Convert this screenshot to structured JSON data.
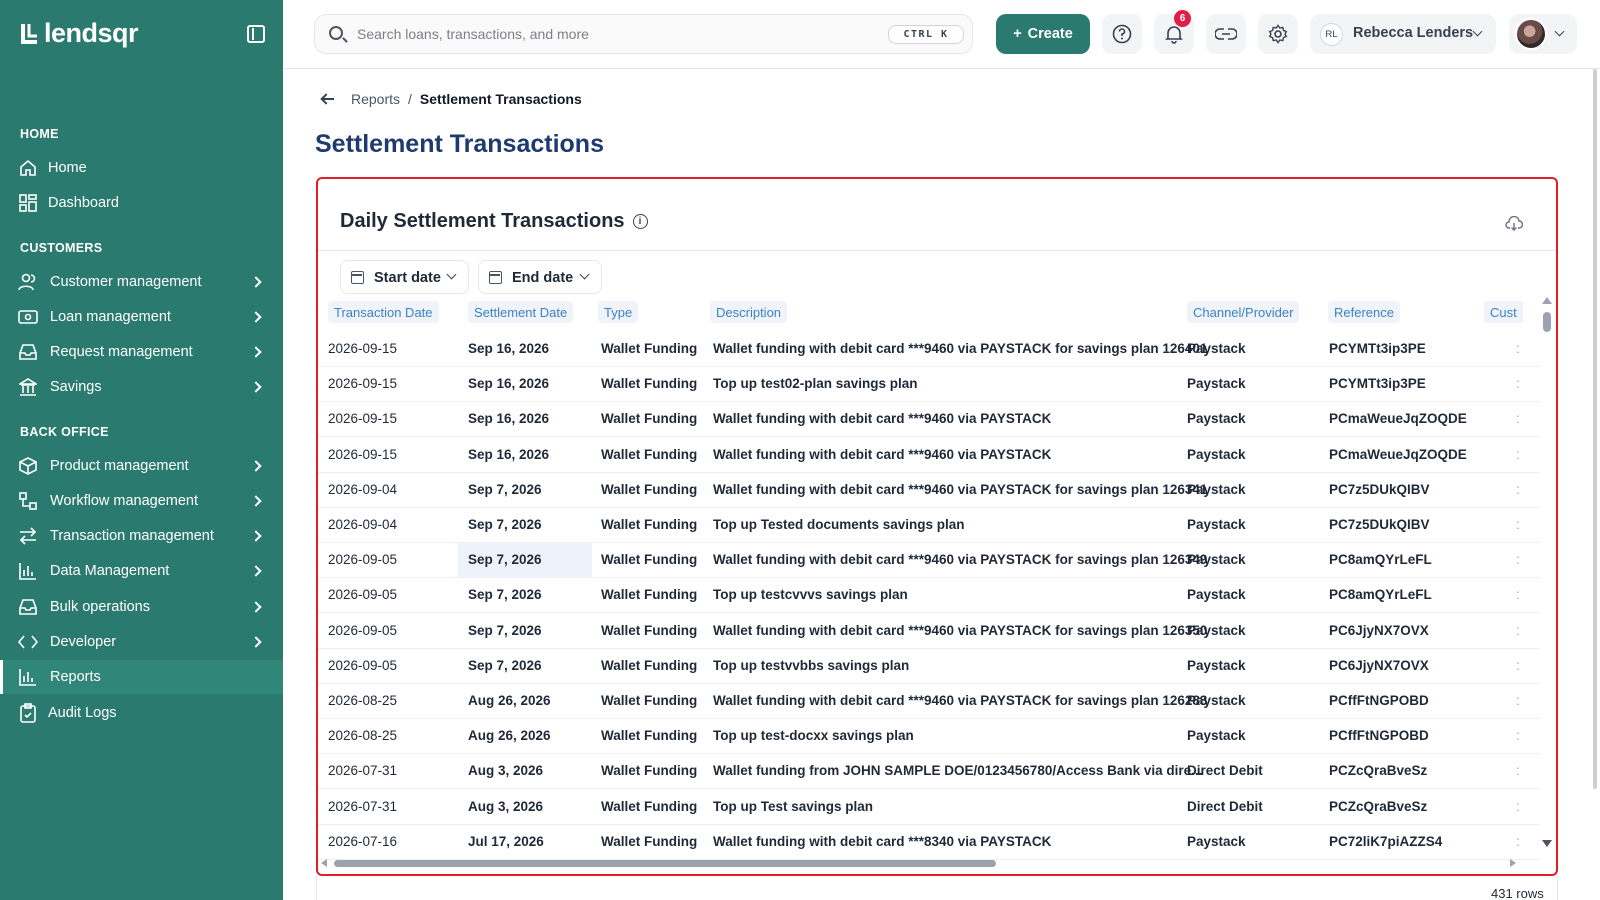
{
  "brand": {
    "name": "lendsqr"
  },
  "sidebar": {
    "sections": {
      "home": "HOME",
      "customers": "CUSTOMERS",
      "back_office": "BACK OFFICE"
    },
    "items": [
      {
        "label": "Home",
        "icon": "home-icon"
      },
      {
        "label": "Dashboard",
        "icon": "dashboard-icon"
      },
      {
        "label": "Customer management",
        "icon": "users-icon"
      },
      {
        "label": "Loan management",
        "icon": "loan-icon"
      },
      {
        "label": "Request management",
        "icon": "inbox-icon"
      },
      {
        "label": "Savings",
        "icon": "savings-icon"
      },
      {
        "label": "Product management",
        "icon": "box-icon"
      },
      {
        "label": "Workflow management",
        "icon": "workflow-icon"
      },
      {
        "label": "Transaction management",
        "icon": "transfer-icon"
      },
      {
        "label": "Data Management",
        "icon": "bar-chart-icon"
      },
      {
        "label": "Bulk operations",
        "icon": "inbox-icon"
      },
      {
        "label": "Developer",
        "icon": "code-icon"
      },
      {
        "label": "Reports",
        "icon": "bar-chart-icon"
      },
      {
        "label": "Audit Logs",
        "icon": "clipboard-icon"
      }
    ]
  },
  "topbar": {
    "search_placeholder": "Search loans, transactions, and more",
    "shortcut": "CTRL K",
    "create_label": "Create",
    "notifications_count": "6",
    "user_initials": "RL",
    "user_name": "Rebecca Lenders"
  },
  "breadcrumb": {
    "parent": "Reports",
    "separator": "/",
    "current": "Settlement Transactions"
  },
  "page_title": "Settlement Transactions",
  "report": {
    "title": "Daily Settlement Transactions",
    "start_date_label": "Start date",
    "end_date_label": "End date",
    "columns": [
      "Transaction Date",
      "Settlement Date",
      "Type",
      "Description",
      "Channel/Provider",
      "Reference",
      "Cust"
    ],
    "rows": [
      [
        "2026-09-15",
        "Sep 16, 2026",
        "Wallet Funding",
        "Wallet funding with debit card ***9460 via PAYSTACK for savings plan 126401",
        "Paystack",
        "PCYMTt3ip3PE"
      ],
      [
        "2026-09-15",
        "Sep 16, 2026",
        "Wallet Funding",
        "Top up test02-plan savings plan",
        "Paystack",
        "PCYMTt3ip3PE"
      ],
      [
        "2026-09-15",
        "Sep 16, 2026",
        "Wallet Funding",
        "Wallet funding with debit card ***9460 via PAYSTACK",
        "Paystack",
        "PCmaWeueJqZOQDE"
      ],
      [
        "2026-09-15",
        "Sep 16, 2026",
        "Wallet Funding",
        "Wallet funding with debit card ***9460 via PAYSTACK",
        "Paystack",
        "PCmaWeueJqZOQDE"
      ],
      [
        "2026-09-04",
        "Sep 7, 2026",
        "Wallet Funding",
        "Wallet funding with debit card ***9460 via PAYSTACK for savings plan 126341",
        "Paystack",
        "PC7z5DUkQIBV"
      ],
      [
        "2026-09-04",
        "Sep 7, 2026",
        "Wallet Funding",
        "Top up Tested documents savings plan",
        "Paystack",
        "PC7z5DUkQIBV"
      ],
      [
        "2026-09-05",
        "Sep 7, 2026",
        "Wallet Funding",
        "Wallet funding with debit card ***9460 via PAYSTACK for savings plan 126349",
        "Paystack",
        "PC8amQYrLeFL"
      ],
      [
        "2026-09-05",
        "Sep 7, 2026",
        "Wallet Funding",
        "Top up testcvvvs savings plan",
        "Paystack",
        "PC8amQYrLeFL"
      ],
      [
        "2026-09-05",
        "Sep 7, 2026",
        "Wallet Funding",
        "Wallet funding with debit card ***9460 via PAYSTACK for savings plan 126350",
        "Paystack",
        "PC6JjyNX7OVX"
      ],
      [
        "2026-09-05",
        "Sep 7, 2026",
        "Wallet Funding",
        "Top up testvvbbs savings plan",
        "Paystack",
        "PC6JjyNX7OVX"
      ],
      [
        "2026-08-25",
        "Aug 26, 2026",
        "Wallet Funding",
        "Wallet funding with debit card ***9460 via PAYSTACK for savings plan 126283",
        "Paystack",
        "PCffFtNGPOBD"
      ],
      [
        "2026-08-25",
        "Aug 26, 2026",
        "Wallet Funding",
        "Top up test-docxx savings plan",
        "Paystack",
        "PCffFtNGPOBD"
      ],
      [
        "2026-07-31",
        "Aug 3, 2026",
        "Wallet Funding",
        "Wallet funding from JOHN SAMPLE DOE/0123456780/Access Bank via dire...",
        "Direct Debit",
        "PCZcQraBveSz"
      ],
      [
        "2026-07-31",
        "Aug 3, 2026",
        "Wallet Funding",
        "Top up Test savings plan",
        "Direct Debit",
        "PCZcQraBveSz"
      ],
      [
        "2026-07-16",
        "Jul 17, 2026",
        "Wallet Funding",
        "Wallet funding with debit card ***8340 via PAYSTACK",
        "Paystack",
        "PC72liK7piAZZS4"
      ]
    ],
    "row_count": "431 rows"
  },
  "colors": {
    "sidebar": "#2a7a6f",
    "accent": "#2a7a6f",
    "title": "#1e3a6e",
    "highlight_border": "#e11d2a",
    "header_text": "#3b82c4"
  }
}
